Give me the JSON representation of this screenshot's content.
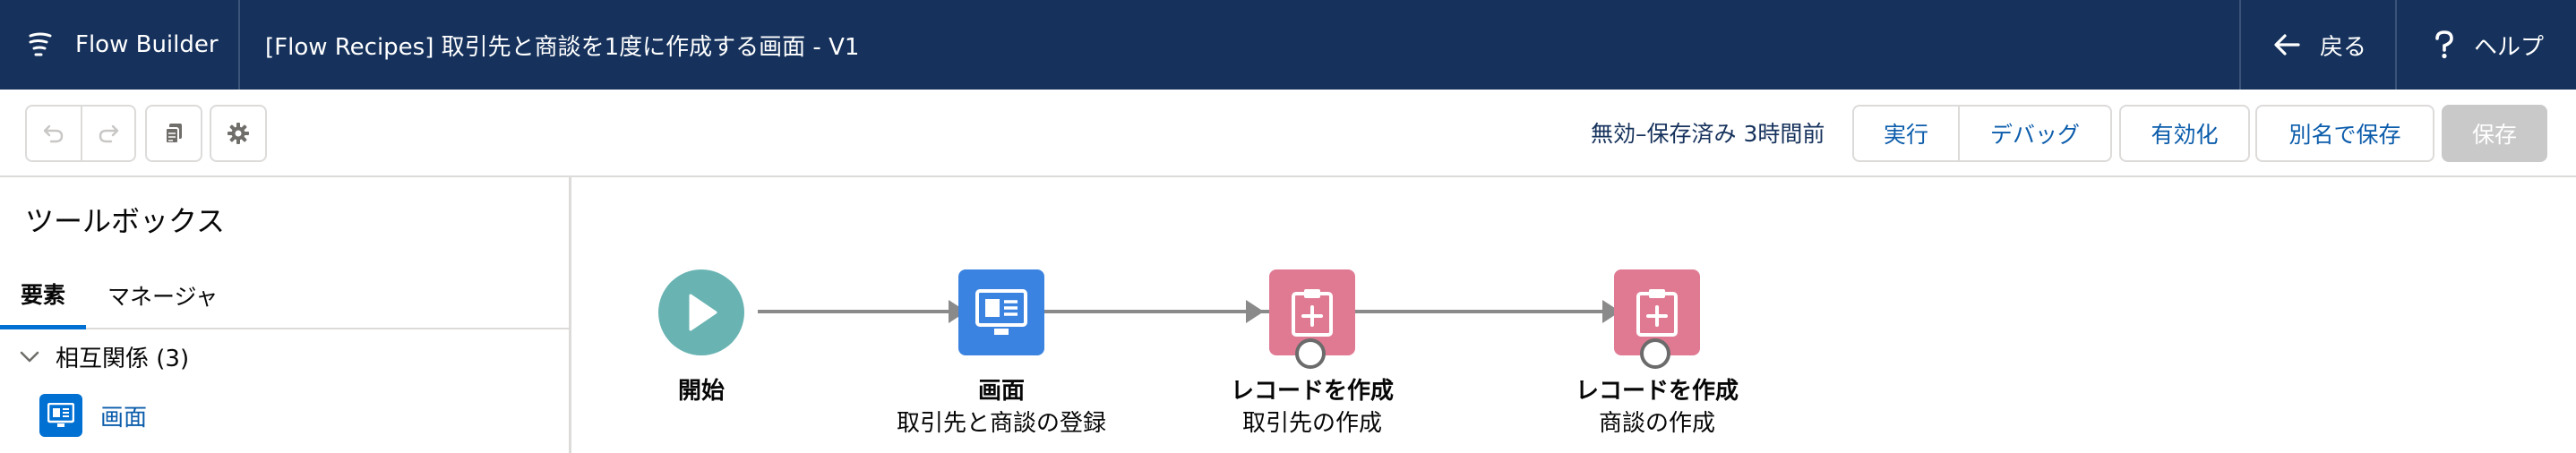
{
  "header": {
    "app_name": "Flow Builder",
    "flow_title": "[Flow Recipes] 取引先と商談を1度に作成する画面 - V1",
    "back_label": "戻る",
    "help_label": "ヘルプ"
  },
  "toolbar": {
    "status": "無効–保存済み 3時間前",
    "run_label": "実行",
    "debug_label": "デバッグ",
    "activate_label": "有効化",
    "save_as_label": "別名で保存",
    "save_label": "保存"
  },
  "toolbox": {
    "title": "ツールボックス",
    "tabs": [
      {
        "label": "要素"
      },
      {
        "label": "マネージャ"
      }
    ],
    "section": {
      "label": "相互関係 (3)",
      "items": [
        {
          "label": "画面",
          "icon": "screen-icon"
        }
      ]
    }
  },
  "canvas": {
    "nodes": [
      {
        "type": "start",
        "label": "開始",
        "sublabel": "",
        "icon": "play-icon"
      },
      {
        "type": "screen",
        "label": "画面",
        "sublabel": "取引先と商談の登録",
        "icon": "screen-icon"
      },
      {
        "type": "create-record",
        "label": "レコードを作成",
        "sublabel": "取引先の作成",
        "icon": "record-create-icon"
      },
      {
        "type": "create-record",
        "label": "レコードを作成",
        "sublabel": "商談の作成",
        "icon": "record-create-icon"
      }
    ]
  },
  "colors": {
    "header_bg": "#16325c",
    "start_node": "#69b4b3",
    "screen_node": "#3a83e0",
    "record_node": "#e07a93",
    "link_blue": "#0b5cab",
    "accent": "#0070d2"
  }
}
